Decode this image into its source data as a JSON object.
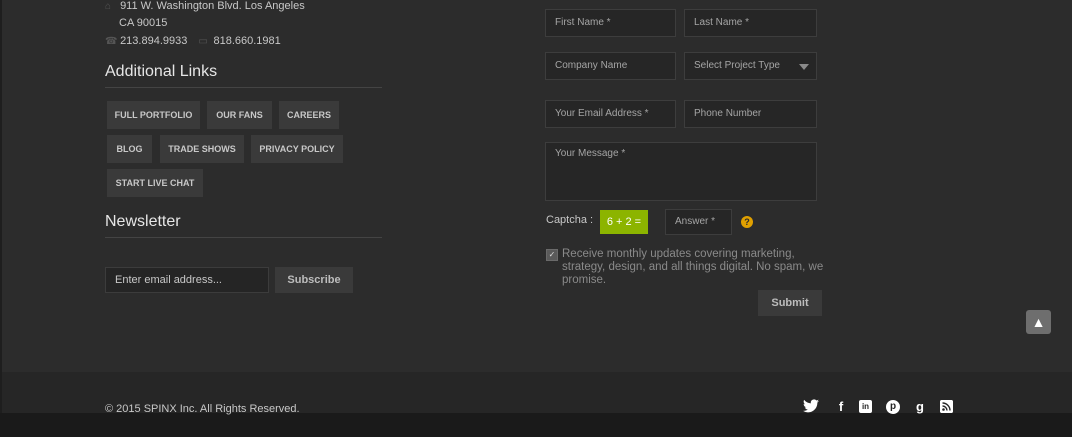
{
  "contact": {
    "address_line1": "911 W. Washington Blvd. Los Angeles",
    "address_line2": "CA 90015",
    "phone": "213.894.9933",
    "fax": "818.660.1981"
  },
  "additional_links": {
    "title": "Additional Links",
    "items": [
      "FULL PORTFOLIO",
      "OUR FANS",
      "CAREERS",
      "BLOG",
      "TRADE SHOWS",
      "PRIVACY POLICY",
      "START LIVE CHAT"
    ]
  },
  "newsletter": {
    "title": "Newsletter",
    "email_placeholder": "Enter email address...",
    "subscribe_label": "Subscribe"
  },
  "form": {
    "first_name": "First Name *",
    "last_name": "Last Name *",
    "company": "Company Name",
    "project_type": "Select Project Type",
    "email": "Your Email Address *",
    "phone": "Phone Number",
    "message": "Your Message *",
    "captcha_label": "Captcha :",
    "captcha_question": "6 + 2 =",
    "captcha_answer": "Answer *",
    "help": "?",
    "optin_text": "Receive monthly updates covering marketing, strategy, design, and all things digital. No spam, we promise.",
    "optin_checked": true,
    "submit_label": "Submit"
  },
  "footer": {
    "copyright": "© 2015 SPINX Inc. All Rights Reserved.",
    "social": [
      "twitter-icon",
      "facebook-icon",
      "linkedin-icon",
      "pinterest-icon",
      "google-plus-icon",
      "rss-icon"
    ]
  },
  "colors": {
    "background": "#2c2c2c",
    "captcha_accent": "#8cb400",
    "help_accent": "#e0a000"
  }
}
